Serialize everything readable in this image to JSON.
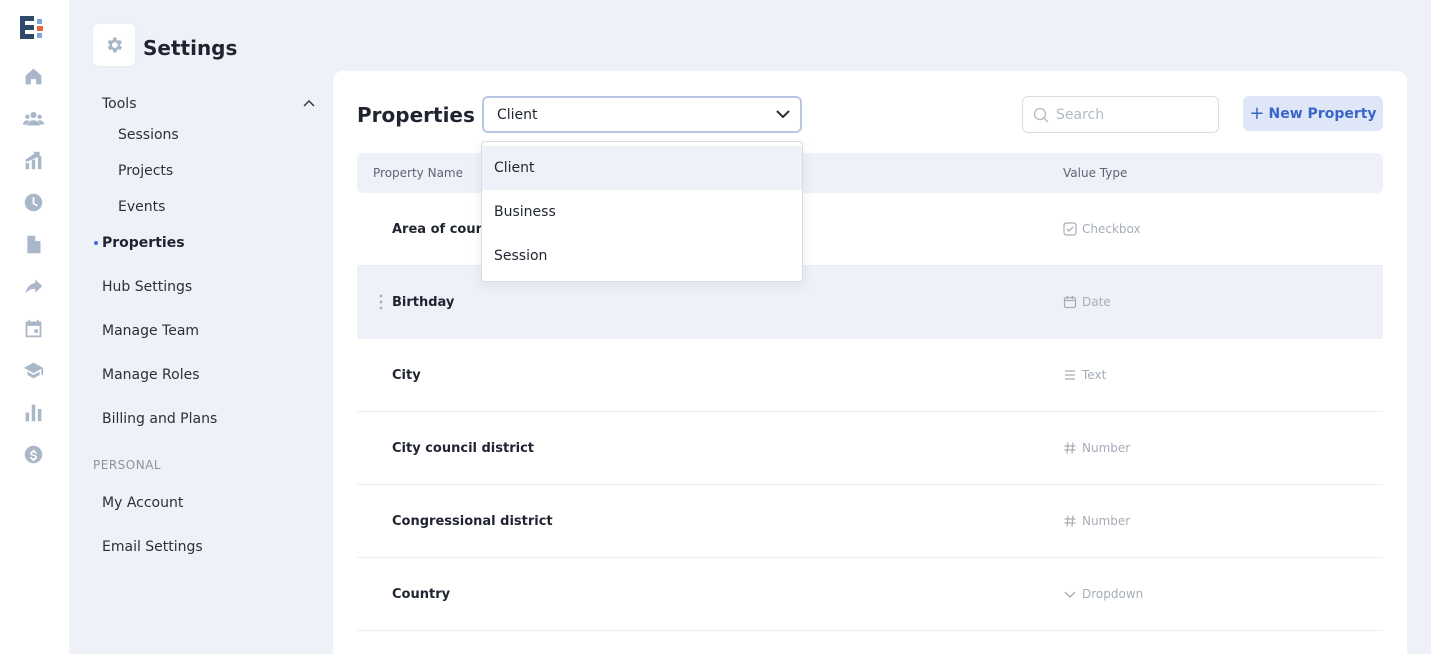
{
  "app": {
    "page_title": "Settings",
    "rail_icons": [
      "home-icon",
      "clients-icon",
      "growth-icon",
      "clock-icon",
      "file-icon",
      "share-icon",
      "calendar-icon",
      "education-icon",
      "reports-icon",
      "dollar-icon"
    ]
  },
  "settings_nav": {
    "tools_label": "Tools",
    "tools_items": [
      "Sessions",
      "Projects",
      "Events"
    ],
    "active_item": "Properties",
    "items": [
      "Hub Settings",
      "Manage Team",
      "Manage Roles",
      "Billing and Plans"
    ],
    "personal_section": "PERSONAL",
    "personal_items": [
      "My Account",
      "Email Settings"
    ]
  },
  "main": {
    "title": "Properties",
    "select_value": "Client",
    "search_placeholder": "Search",
    "new_button_label": "New Property",
    "columns": [
      "Property Name",
      "Value Type"
    ],
    "rows": [
      {
        "name": "Area of counsel",
        "type": "Checkbox",
        "icon": "checkbox-icon"
      },
      {
        "name": "Birthday",
        "type": "Date",
        "icon": "calendar-icon"
      },
      {
        "name": "City",
        "type": "Text",
        "icon": "text-lines-icon"
      },
      {
        "name": "City council district",
        "type": "Number",
        "icon": "hash-icon"
      },
      {
        "name": "Congressional district",
        "type": "Number",
        "icon": "hash-icon"
      },
      {
        "name": "Country",
        "type": "Dropdown",
        "icon": "chevron-down-icon"
      }
    ]
  },
  "dropdown": {
    "options": [
      "Client",
      "Business",
      "Session"
    ],
    "selected": "Client"
  },
  "colors": {
    "accent": "#3b66c9",
    "background": "#eff1f9",
    "icon_muted": "#a9b7c9"
  }
}
